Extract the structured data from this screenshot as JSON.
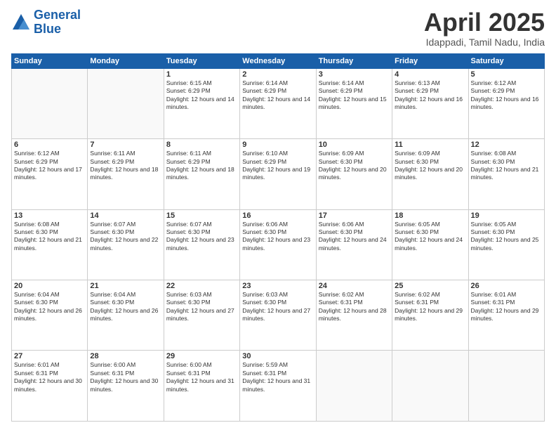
{
  "logo": {
    "line1": "General",
    "line2": "Blue"
  },
  "title": {
    "month_year": "April 2025",
    "location": "Idappadi, Tamil Nadu, India"
  },
  "days_of_week": [
    "Sunday",
    "Monday",
    "Tuesday",
    "Wednesday",
    "Thursday",
    "Friday",
    "Saturday"
  ],
  "weeks": [
    [
      {
        "day": "",
        "info": ""
      },
      {
        "day": "",
        "info": ""
      },
      {
        "day": "1",
        "info": "Sunrise: 6:15 AM\nSunset: 6:29 PM\nDaylight: 12 hours and 14 minutes."
      },
      {
        "day": "2",
        "info": "Sunrise: 6:14 AM\nSunset: 6:29 PM\nDaylight: 12 hours and 14 minutes."
      },
      {
        "day": "3",
        "info": "Sunrise: 6:14 AM\nSunset: 6:29 PM\nDaylight: 12 hours and 15 minutes."
      },
      {
        "day": "4",
        "info": "Sunrise: 6:13 AM\nSunset: 6:29 PM\nDaylight: 12 hours and 16 minutes."
      },
      {
        "day": "5",
        "info": "Sunrise: 6:12 AM\nSunset: 6:29 PM\nDaylight: 12 hours and 16 minutes."
      }
    ],
    [
      {
        "day": "6",
        "info": "Sunrise: 6:12 AM\nSunset: 6:29 PM\nDaylight: 12 hours and 17 minutes."
      },
      {
        "day": "7",
        "info": "Sunrise: 6:11 AM\nSunset: 6:29 PM\nDaylight: 12 hours and 18 minutes."
      },
      {
        "day": "8",
        "info": "Sunrise: 6:11 AM\nSunset: 6:29 PM\nDaylight: 12 hours and 18 minutes."
      },
      {
        "day": "9",
        "info": "Sunrise: 6:10 AM\nSunset: 6:29 PM\nDaylight: 12 hours and 19 minutes."
      },
      {
        "day": "10",
        "info": "Sunrise: 6:09 AM\nSunset: 6:30 PM\nDaylight: 12 hours and 20 minutes."
      },
      {
        "day": "11",
        "info": "Sunrise: 6:09 AM\nSunset: 6:30 PM\nDaylight: 12 hours and 20 minutes."
      },
      {
        "day": "12",
        "info": "Sunrise: 6:08 AM\nSunset: 6:30 PM\nDaylight: 12 hours and 21 minutes."
      }
    ],
    [
      {
        "day": "13",
        "info": "Sunrise: 6:08 AM\nSunset: 6:30 PM\nDaylight: 12 hours and 21 minutes."
      },
      {
        "day": "14",
        "info": "Sunrise: 6:07 AM\nSunset: 6:30 PM\nDaylight: 12 hours and 22 minutes."
      },
      {
        "day": "15",
        "info": "Sunrise: 6:07 AM\nSunset: 6:30 PM\nDaylight: 12 hours and 23 minutes."
      },
      {
        "day": "16",
        "info": "Sunrise: 6:06 AM\nSunset: 6:30 PM\nDaylight: 12 hours and 23 minutes."
      },
      {
        "day": "17",
        "info": "Sunrise: 6:06 AM\nSunset: 6:30 PM\nDaylight: 12 hours and 24 minutes."
      },
      {
        "day": "18",
        "info": "Sunrise: 6:05 AM\nSunset: 6:30 PM\nDaylight: 12 hours and 24 minutes."
      },
      {
        "day": "19",
        "info": "Sunrise: 6:05 AM\nSunset: 6:30 PM\nDaylight: 12 hours and 25 minutes."
      }
    ],
    [
      {
        "day": "20",
        "info": "Sunrise: 6:04 AM\nSunset: 6:30 PM\nDaylight: 12 hours and 26 minutes."
      },
      {
        "day": "21",
        "info": "Sunrise: 6:04 AM\nSunset: 6:30 PM\nDaylight: 12 hours and 26 minutes."
      },
      {
        "day": "22",
        "info": "Sunrise: 6:03 AM\nSunset: 6:30 PM\nDaylight: 12 hours and 27 minutes."
      },
      {
        "day": "23",
        "info": "Sunrise: 6:03 AM\nSunset: 6:30 PM\nDaylight: 12 hours and 27 minutes."
      },
      {
        "day": "24",
        "info": "Sunrise: 6:02 AM\nSunset: 6:31 PM\nDaylight: 12 hours and 28 minutes."
      },
      {
        "day": "25",
        "info": "Sunrise: 6:02 AM\nSunset: 6:31 PM\nDaylight: 12 hours and 29 minutes."
      },
      {
        "day": "26",
        "info": "Sunrise: 6:01 AM\nSunset: 6:31 PM\nDaylight: 12 hours and 29 minutes."
      }
    ],
    [
      {
        "day": "27",
        "info": "Sunrise: 6:01 AM\nSunset: 6:31 PM\nDaylight: 12 hours and 30 minutes."
      },
      {
        "day": "28",
        "info": "Sunrise: 6:00 AM\nSunset: 6:31 PM\nDaylight: 12 hours and 30 minutes."
      },
      {
        "day": "29",
        "info": "Sunrise: 6:00 AM\nSunset: 6:31 PM\nDaylight: 12 hours and 31 minutes."
      },
      {
        "day": "30",
        "info": "Sunrise: 5:59 AM\nSunset: 6:31 PM\nDaylight: 12 hours and 31 minutes."
      },
      {
        "day": "",
        "info": ""
      },
      {
        "day": "",
        "info": ""
      },
      {
        "day": "",
        "info": ""
      }
    ]
  ]
}
